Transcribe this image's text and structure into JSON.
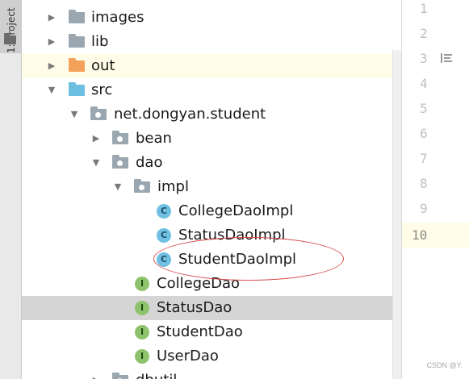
{
  "side_panel": {
    "tab_label": "1: Project"
  },
  "tree": {
    "rows": [
      {
        "label": "images"
      },
      {
        "label": "lib"
      },
      {
        "label": "out"
      },
      {
        "label": "src"
      },
      {
        "label": "net.dongyan.student"
      },
      {
        "label": "bean"
      },
      {
        "label": "dao"
      },
      {
        "label": "impl"
      },
      {
        "label": "CollegeDaoImpl",
        "badge": "C"
      },
      {
        "label": "StatusDaoImpl",
        "badge": "C"
      },
      {
        "label": "StudentDaoImpl",
        "badge": "C"
      },
      {
        "label": "CollegeDao",
        "badge": "I"
      },
      {
        "label": "StatusDao",
        "badge": "I"
      },
      {
        "label": "StudentDao",
        "badge": "I"
      },
      {
        "label": "UserDao",
        "badge": "I"
      },
      {
        "label": "dbutil"
      }
    ]
  },
  "editor": {
    "line_numbers": [
      "1",
      "2",
      "3",
      "4",
      "5",
      "6",
      "7",
      "8",
      "9",
      "10"
    ],
    "current_line": "10"
  },
  "colors": {
    "folder": "#9aa7b0",
    "excluded_folder": "#f4a25b",
    "source_folder": "#6bbfe0",
    "class_badge": "#6fc0e3",
    "interface_badge": "#8fc36b",
    "annotation": "#d84a4a"
  },
  "watermark": "CSDN @Y."
}
